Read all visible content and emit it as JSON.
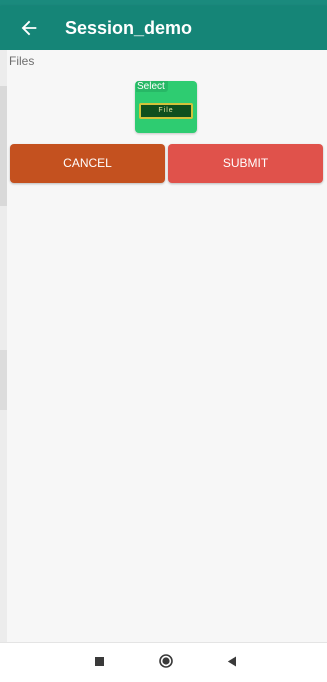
{
  "app_bar": {
    "title": "Session_demo",
    "back_icon": "arrow-left-icon",
    "background": "#158577"
  },
  "content": {
    "files_label": "Files",
    "select_file": {
      "label": "Select",
      "button_label": "File",
      "background": "#2ecc71"
    },
    "buttons": {
      "cancel_label": "CANCEL",
      "cancel_color": "#c4511f",
      "submit_label": "SUBMIT",
      "submit_color": "#e0524b"
    }
  },
  "nav_bar": {
    "items": [
      {
        "name": "recents",
        "icon": "square-icon"
      },
      {
        "name": "home",
        "icon": "circle-icon"
      },
      {
        "name": "back",
        "icon": "triangle-back-icon"
      }
    ]
  }
}
